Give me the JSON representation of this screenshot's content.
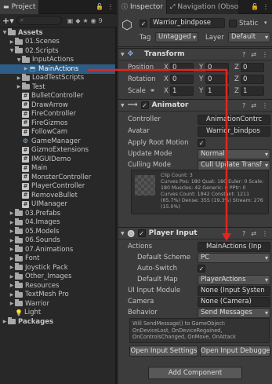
{
  "project": {
    "tab_label": "Project",
    "toolbar_count": "9",
    "tree": [
      {
        "label": "Assets",
        "depth": 0,
        "arrow": "▼",
        "icon": "folder",
        "bold": true
      },
      {
        "label": "01.Scenes",
        "depth": 1,
        "arrow": "▶",
        "icon": "folder"
      },
      {
        "label": "02.Scripts",
        "depth": 1,
        "arrow": "▼",
        "icon": "folder"
      },
      {
        "label": "InputActions",
        "depth": 2,
        "arrow": "▼",
        "icon": "folder"
      },
      {
        "label": "MainActions",
        "depth": 3,
        "arrow": "▶",
        "icon": "input-actions",
        "selected": true
      },
      {
        "label": "LoadTestScripts",
        "depth": 2,
        "arrow": "▶",
        "icon": "folder"
      },
      {
        "label": "Test",
        "depth": 2,
        "arrow": "▶",
        "icon": "folder"
      },
      {
        "label": "BulletController",
        "depth": 2,
        "icon": "script"
      },
      {
        "label": "DrawArrow",
        "depth": 2,
        "icon": "script"
      },
      {
        "label": "FireController",
        "depth": 2,
        "icon": "script"
      },
      {
        "label": "FireGizmos",
        "depth": 2,
        "icon": "script"
      },
      {
        "label": "FollowCam",
        "depth": 2,
        "icon": "script"
      },
      {
        "label": "GameManager",
        "depth": 2,
        "icon": "gear"
      },
      {
        "label": "GizmoExtensions",
        "depth": 2,
        "icon": "script"
      },
      {
        "label": "IMGUIDemo",
        "depth": 2,
        "icon": "script"
      },
      {
        "label": "Main",
        "depth": 2,
        "icon": "script"
      },
      {
        "label": "MonsterController",
        "depth": 2,
        "icon": "script"
      },
      {
        "label": "PlayerController",
        "depth": 2,
        "icon": "script"
      },
      {
        "label": "RemoveBullet",
        "depth": 2,
        "icon": "script"
      },
      {
        "label": "UIManager",
        "depth": 2,
        "icon": "script"
      },
      {
        "label": "03.Prefabs",
        "depth": 1,
        "arrow": "▶",
        "icon": "folder"
      },
      {
        "label": "04.Images",
        "depth": 1,
        "arrow": "▶",
        "icon": "folder"
      },
      {
        "label": "05.Models",
        "depth": 1,
        "arrow": "▶",
        "icon": "folder"
      },
      {
        "label": "06.Sounds",
        "depth": 1,
        "arrow": "▶",
        "icon": "folder"
      },
      {
        "label": "07.Animations",
        "depth": 1,
        "arrow": "▶",
        "icon": "folder"
      },
      {
        "label": "Font",
        "depth": 1,
        "arrow": "▶",
        "icon": "folder"
      },
      {
        "label": "Joystick Pack",
        "depth": 1,
        "arrow": "▶",
        "icon": "folder"
      },
      {
        "label": "Other_Images",
        "depth": 1,
        "arrow": "▶",
        "icon": "folder"
      },
      {
        "label": "Resources",
        "depth": 1,
        "arrow": "▶",
        "icon": "folder"
      },
      {
        "label": "TextMesh Pro",
        "depth": 1,
        "arrow": "▶",
        "icon": "folder"
      },
      {
        "label": "Warrior",
        "depth": 1,
        "arrow": "▶",
        "icon": "folder"
      },
      {
        "label": "Light",
        "depth": 1,
        "icon": "light"
      },
      {
        "label": "Packages",
        "depth": 0,
        "arrow": "▶",
        "icon": "folder",
        "bold": true
      }
    ]
  },
  "inspector": {
    "tab_inspector": "Inspector",
    "tab_navigation": "Navigation (Obso",
    "object_name": "Warrior_bindpose",
    "static_label": "Static",
    "tag_label": "Tag",
    "tag_value": "Untagged",
    "layer_label": "Layer",
    "layer_value": "Default"
  },
  "transform": {
    "title": "Transform",
    "position_label": "Position",
    "rotation_label": "Rotation",
    "scale_label": "Scale",
    "position": {
      "x": "0",
      "y": "0",
      "z": "0"
    },
    "rotation": {
      "x": "0",
      "y": "0",
      "z": "0"
    },
    "scale": {
      "x": "1",
      "y": "1",
      "z": "1"
    }
  },
  "animator": {
    "title": "Animator",
    "controller_label": "Controller",
    "controller_value": "AnimationContrc",
    "avatar_label": "Avatar",
    "avatar_value": "Warrior_bindpos",
    "apply_root_motion_label": "Apply Root Motion",
    "apply_root_motion": "✓",
    "update_mode_label": "Update Mode",
    "update_mode_value": "Normal",
    "culling_mode_label": "Culling Mode",
    "culling_mode_value": "Cull Update Transf",
    "info": "Clip Count: 3\nCurves Pos: 180 Quat: 180 Euler: 0 Scale: 180 Muscles: 42 Generic: 0 PPtr: 0\nCurves Count: 1842 Constant: 1211 (65.7%) Dense: 355 (19.3%) Stream: 276 (15.0%)"
  },
  "player_input": {
    "title": "Player Input",
    "actions_label": "Actions",
    "actions_value": "MainActions (Inp",
    "default_scheme_label": "Default Scheme",
    "default_scheme_value": "PC",
    "auto_switch_label": "Auto-Switch",
    "auto_switch": "✓",
    "default_map_label": "Default Map",
    "default_map_value": "PlayerActions",
    "ui_input_module_label": "UI Input Module",
    "ui_input_module_value": "None (Input Systen",
    "camera_label": "Camera",
    "camera_value": "None (Camera)",
    "behavior_label": "Behavior",
    "behavior_value": "Send Messages",
    "message": "Will SendMessage() to GameObject:\nOnDeviceLost, OnDeviceRegained,\nOnControlsChanged, OnMove, OnAttack",
    "open_settings_label": "Open Input Settings",
    "open_debugger_label": "Open Input Debugger"
  },
  "add_component_label": "Add Component",
  "arrow_color": "#e8231c"
}
